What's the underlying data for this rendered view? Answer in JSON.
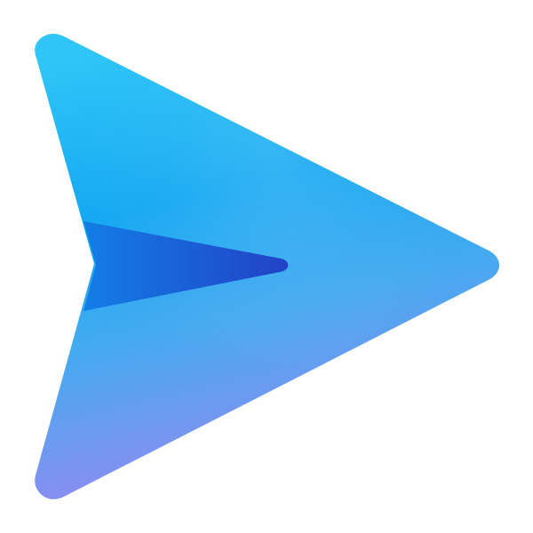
{
  "icon": {
    "name": "send-icon",
    "shape": "paper-plane",
    "colors": {
      "top": "#2fc6f7",
      "middle": "#14a8f2",
      "bottom": "#9b86f2",
      "fold_light": "#137de6",
      "fold_dark": "#2142c5",
      "background": "#ffffff"
    }
  }
}
